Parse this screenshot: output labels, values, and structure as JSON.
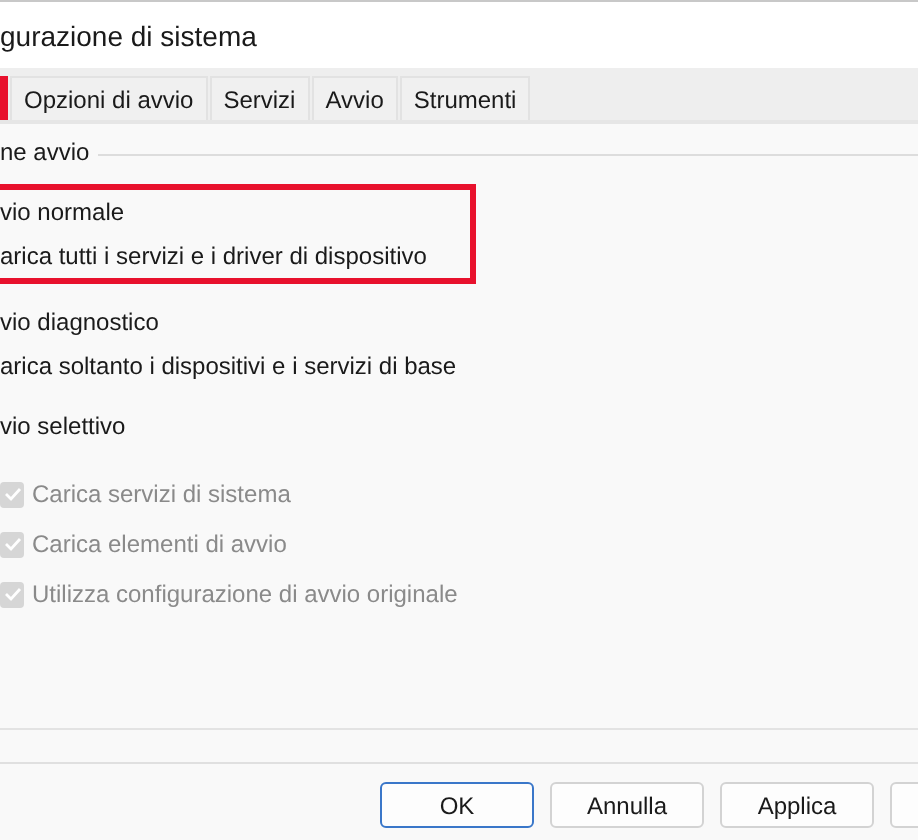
{
  "window": {
    "title": "gurazione di sistema"
  },
  "tabs": [
    {
      "highlighted": true
    },
    {
      "label": "Opzioni di avvio",
      "highlighted": false
    },
    {
      "label": "Servizi",
      "highlighted": false
    },
    {
      "label": "Avvio",
      "highlighted": false
    },
    {
      "label": "Strumenti",
      "highlighted": false
    }
  ],
  "group": {
    "label": "ne avvio",
    "options": [
      {
        "label": "vio normale",
        "description": "arica tutti i servizi e i driver di dispositivo",
        "highlighted": true
      },
      {
        "label": "vio diagnostico",
        "description": "arica soltanto i dispositivi e i servizi di base",
        "highlighted": false
      },
      {
        "label": "vio selettivo",
        "highlighted": false
      }
    ],
    "checkboxes": [
      {
        "label": "Carica servizi di sistema",
        "checked": true,
        "disabled": true
      },
      {
        "label": "Carica elementi di avvio",
        "checked": true,
        "disabled": true
      },
      {
        "label": "Utilizza configurazione di avvio originale",
        "checked": true,
        "disabled": true
      }
    ]
  },
  "buttons": [
    {
      "label": "OK",
      "default": true
    },
    {
      "label": "Annulla",
      "default": false
    },
    {
      "label": "Applica",
      "default": false
    },
    {
      "default": false
    }
  ]
}
